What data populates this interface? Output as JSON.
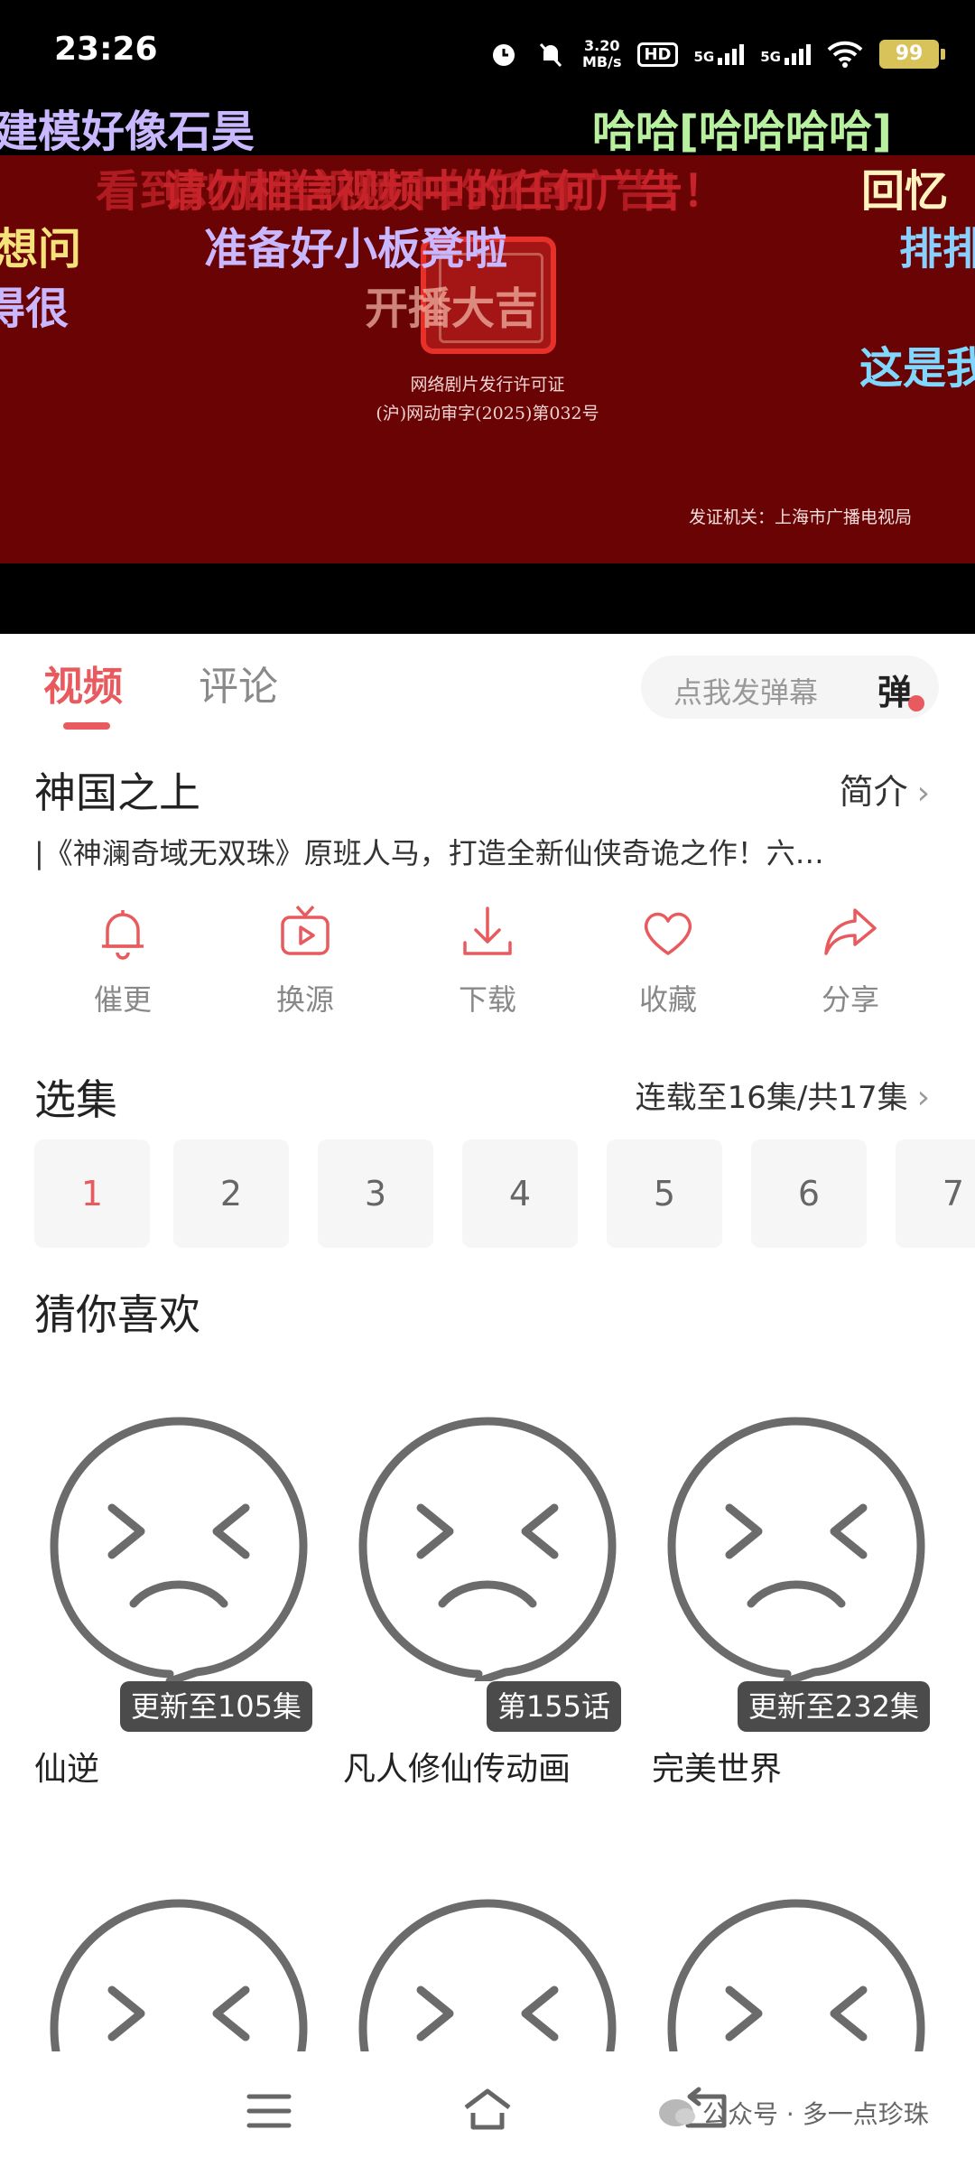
{
  "status_bar": {
    "time": "23:26",
    "net_speed_value": "3.20",
    "net_speed_unit": "MB/s",
    "hd_label": "HD",
    "sim1_label": "5G",
    "sim2_label": "5G",
    "battery": "99"
  },
  "player": {
    "license_line1": "网络剧片发行许可证",
    "license_line2": "(沪)网动审字(2025)第032号",
    "issuer": "发证机关：上海市广播电视局",
    "danmaku": [
      {
        "text": "建模好像石昊",
        "color": "#c9b8ff"
      },
      {
        "text": "哈哈[哈哈哈哈]",
        "color": "#b8f0a0"
      },
      {
        "text": "看到刘相信视频中的任何广告！",
        "color": "#c6232a"
      },
      {
        "text": "请勿相信视频中的任何广告！",
        "color": "#c6232a"
      },
      {
        "text": "回忆",
        "color": "#fff3c0"
      },
      {
        "text": "想问",
        "color": "#f5e27a"
      },
      {
        "text": "准备好小板凳啦",
        "color": "#c9b8ff"
      },
      {
        "text": "排排",
        "color": "#8ad0ff"
      },
      {
        "text": "开播大吉",
        "color": "#f0b0a0"
      },
      {
        "text": "得很",
        "color": "#c9b8ff"
      },
      {
        "text": "这是我",
        "color": "#7fd8ff"
      }
    ]
  },
  "tabs": {
    "video": "视频",
    "comment": "评论",
    "danmaku_placeholder": "点我发弹幕",
    "danmaku_toggle": "弹"
  },
  "show": {
    "title": "神国之上",
    "intro_label": "简介",
    "description": "|《神澜奇域无双珠》原班人马，打造全新仙侠奇诡之作！六…"
  },
  "actions": [
    {
      "label": "催更",
      "icon": "bell-icon"
    },
    {
      "label": "换源",
      "icon": "tv-play-icon"
    },
    {
      "label": "下载",
      "icon": "download-icon"
    },
    {
      "label": "收藏",
      "icon": "heart-icon"
    },
    {
      "label": "分享",
      "icon": "share-icon"
    }
  ],
  "episodes": {
    "title": "选集",
    "info": "连载至16集/共17集",
    "items": [
      "1",
      "2",
      "3",
      "4",
      "5",
      "6",
      "7"
    ],
    "selected": "1"
  },
  "recommend": {
    "title": "猜你喜欢",
    "items": [
      {
        "name": "仙逆",
        "badge": "更新至105集"
      },
      {
        "name": "凡人修仙传动画",
        "badge": "第155话"
      },
      {
        "name": "完美世界",
        "badge": "更新至232集"
      },
      {
        "name": "",
        "badge": ""
      },
      {
        "name": "",
        "badge": ""
      },
      {
        "name": "",
        "badge": ""
      }
    ]
  },
  "navbar": {
    "watermark": "公众号 · 多一点珍珠"
  },
  "colors": {
    "accent": "#e85a5e",
    "player_bg": "#6a0303",
    "placeholder_face": "#6b6b6b"
  }
}
